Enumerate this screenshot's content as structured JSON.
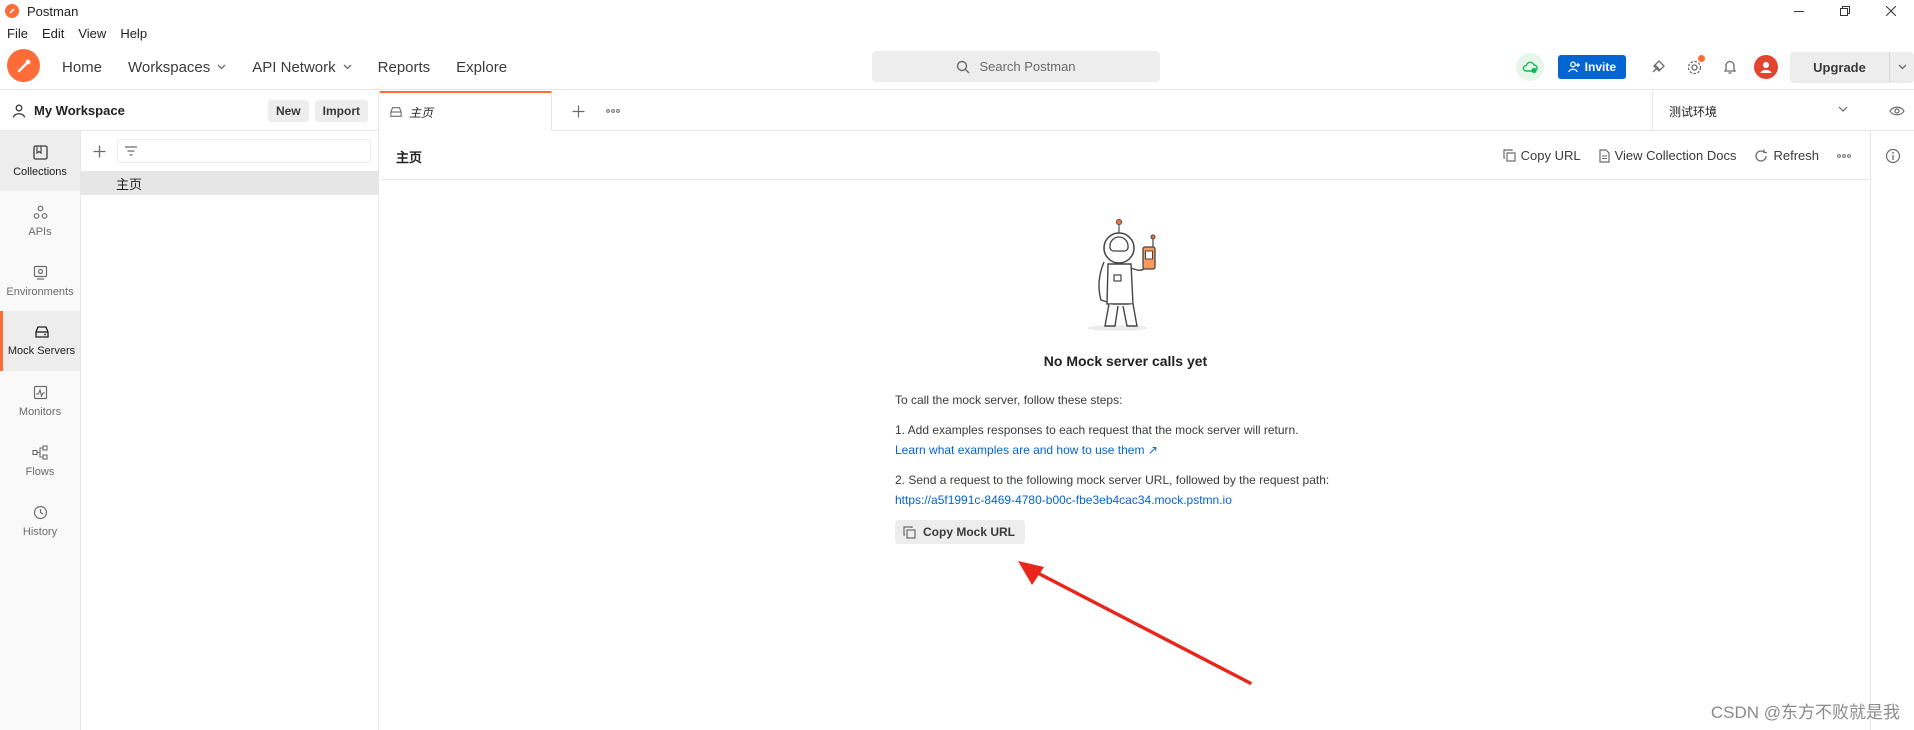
{
  "window": {
    "title": "Postman"
  },
  "menu": [
    "File",
    "Edit",
    "View",
    "Help"
  ],
  "nav": {
    "home": "Home",
    "workspaces": "Workspaces",
    "api_network": "API Network",
    "reports": "Reports",
    "explore": "Explore"
  },
  "search": {
    "placeholder": "Search Postman"
  },
  "header": {
    "invite_label": "Invite",
    "upgrade_label": "Upgrade"
  },
  "workspace": {
    "name": "My Workspace",
    "new_label": "New",
    "import_label": "Import"
  },
  "rail": [
    {
      "label": "Collections",
      "icon": "collections-icon"
    },
    {
      "label": "APIs",
      "icon": "apis-icon"
    },
    {
      "label": "Environments",
      "icon": "environments-icon"
    },
    {
      "label": "Mock Servers",
      "icon": "mock-servers-icon"
    },
    {
      "label": "Monitors",
      "icon": "monitors-icon"
    },
    {
      "label": "Flows",
      "icon": "flows-icon"
    },
    {
      "label": "History",
      "icon": "history-icon"
    }
  ],
  "sidebar_tree": [
    {
      "label": "主页"
    }
  ],
  "tabs": [
    {
      "label": "主页"
    }
  ],
  "environment": {
    "selected": "测试环境"
  },
  "content": {
    "title": "主页",
    "copy_url": "Copy URL",
    "view_docs": "View Collection Docs",
    "refresh": "Refresh"
  },
  "empty_state": {
    "title": "No Mock server calls yet",
    "intro": "To call the mock server, follow these steps:",
    "step1": "1. Add examples responses to each request that the mock server will return.",
    "step1_link": "Learn what examples are and how to use them ↗",
    "step2": "2. Send a request to the following mock server URL, followed by the request path:",
    "mock_url": "https://a5f1991c-8469-4780-b00c-fbe3eb4cac34.mock.pstmn.io",
    "copy_button": "Copy Mock URL"
  },
  "watermark": "CSDN @东方不败就是我",
  "colors": {
    "brand": "#ff6c37",
    "accent_blue": "#0265d2",
    "annotation_arrow": "#e8261c"
  }
}
